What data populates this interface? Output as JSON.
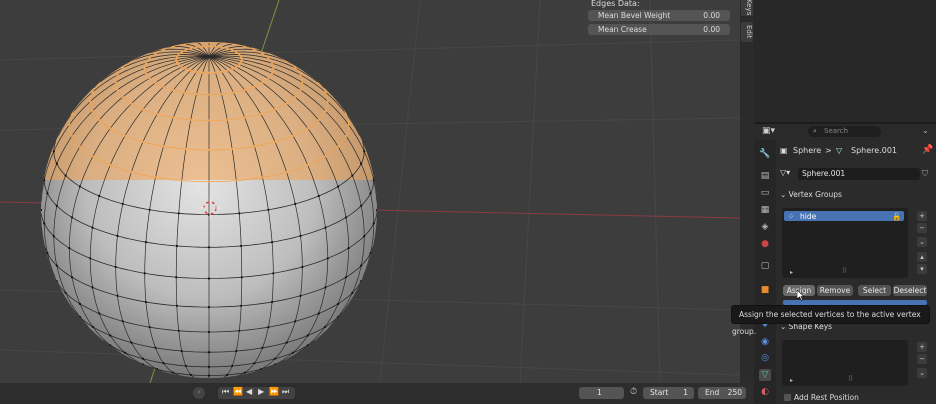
{
  "viewport": {
    "edges_panel": {
      "title": "Edges Data:",
      "fields": [
        {
          "label": "Mean Bevel Weight",
          "value": "0.00"
        },
        {
          "label": "Mean Crease",
          "value": "0.00"
        }
      ]
    }
  },
  "side_tabs": [
    "Keys",
    "Edit"
  ],
  "properties": {
    "search_placeholder": "Search",
    "breadcrumb": {
      "object": "Sphere",
      "separator": ">",
      "mesh": "Sphere.001"
    },
    "datablock_name": "Sphere.001",
    "vertex_groups": {
      "title": "Vertex Groups",
      "items": [
        {
          "name": "hide"
        }
      ],
      "buttons": {
        "assign": "Assign",
        "remove": "Remove",
        "select": "Select",
        "deselect": "Deselect"
      }
    },
    "shape_keys": {
      "title": "Shape Keys"
    },
    "add_rest_position": "Add Rest Position"
  },
  "tooltip": "Assign the selected vertices to the active vertex group.",
  "timeline": {
    "current_frame": "1",
    "start_label": "Start",
    "start_value": "1",
    "end_label": "End",
    "end_value": "250"
  },
  "colors": {
    "accent": "#4772b3",
    "selection": "#f2a34f",
    "viewport_bg": "#3d3d3d"
  }
}
